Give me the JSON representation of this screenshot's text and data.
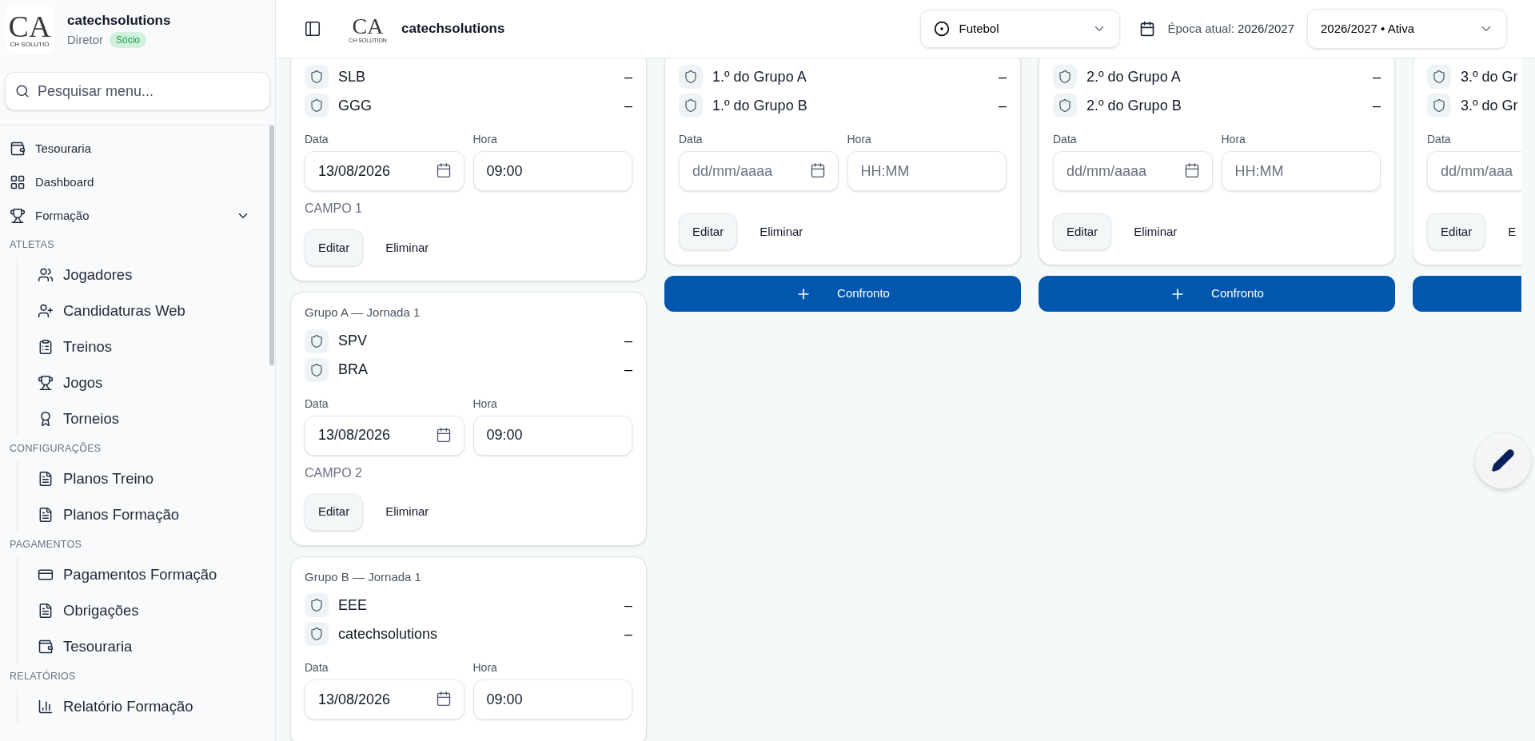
{
  "sidebar": {
    "logo": {
      "mark": "CA",
      "sub": "CH SOLUTIO"
    },
    "org_name": "catechsolutions",
    "role": "Diretor",
    "badge": "Sócio",
    "search": {
      "placeholder": "Pesquisar menu..."
    },
    "items": [
      {
        "kind": "item",
        "label": "Tesouraria"
      },
      {
        "kind": "item",
        "label": "Dashboard"
      },
      {
        "kind": "group",
        "label": "Formação",
        "expanded": true
      },
      {
        "kind": "section",
        "label": "ATLETAS",
        "children": [
          {
            "label": "Jogadores"
          },
          {
            "label": "Candidaturas Web"
          },
          {
            "label": "Treinos"
          },
          {
            "label": "Jogos"
          },
          {
            "label": "Torneios"
          }
        ]
      },
      {
        "kind": "section",
        "label": "CONFIGURAÇÕES",
        "children": [
          {
            "label": "Planos Treino"
          },
          {
            "label": "Planos Formação"
          }
        ]
      },
      {
        "kind": "section",
        "label": "PAGAMENTOS",
        "children": [
          {
            "label": "Pagamentos Formação"
          },
          {
            "label": "Obrigações"
          },
          {
            "label": "Tesouraria"
          }
        ]
      },
      {
        "kind": "section",
        "label": "RELATÓRIOS",
        "children": [
          {
            "label": "Relatório Formação"
          }
        ]
      }
    ]
  },
  "header": {
    "logo": {
      "mark": "CA",
      "sub": "CH SOLUTION"
    },
    "brand": "catechsolutions",
    "sport_select": "Futebol",
    "season_label": "Época atual:",
    "season_value": "2026/2027",
    "season_select": "2026/2027 • Ativa"
  },
  "columns": [
    {
      "matches": [
        {
          "teams": [
            {
              "name": "SLB",
              "score": "–"
            },
            {
              "name": "GGG",
              "score": "–"
            }
          ],
          "date_label": "Data",
          "date": "13/08/2026",
          "time_label": "Hora",
          "time": "09:00",
          "campo": "CAMPO 1",
          "edit": "Editar",
          "delete": "Eliminar"
        },
        {
          "group_label": "Grupo A — Jornada 1",
          "teams": [
            {
              "name": "SPV",
              "score": "–"
            },
            {
              "name": "BRA",
              "score": "–"
            }
          ],
          "date_label": "Data",
          "date": "13/08/2026",
          "time_label": "Hora",
          "time": "09:00",
          "campo": "CAMPO 2",
          "edit": "Editar",
          "delete": "Eliminar"
        },
        {
          "group_label": "Grupo B — Jornada 1",
          "teams": [
            {
              "name": "EEE",
              "score": "–"
            },
            {
              "name": "catechsolutions",
              "score": "–"
            }
          ],
          "date_label": "Data",
          "date": "13/08/2026",
          "time_label": "Hora",
          "time": "09:00"
        }
      ]
    },
    {
      "matches": [
        {
          "teams": [
            {
              "name": "1.º do Grupo A",
              "score": "–"
            },
            {
              "name": "1.º do Grupo B",
              "score": "–"
            }
          ],
          "date_label": "Data",
          "date_placeholder": "dd/mm/aaaa",
          "time_label": "Hora",
          "time_placeholder": "HH:MM",
          "edit": "Editar",
          "delete": "Eliminar"
        }
      ],
      "has_add_button": true,
      "add_label": "Confronto"
    },
    {
      "matches": [
        {
          "teams": [
            {
              "name": "2.º do Grupo A",
              "score": "–"
            },
            {
              "name": "2.º do Grupo B",
              "score": "–"
            }
          ],
          "date_label": "Data",
          "date_placeholder": "dd/mm/aaaa",
          "time_label": "Hora",
          "time_placeholder": "HH:MM",
          "edit": "Editar",
          "delete": "Eliminar"
        }
      ],
      "has_add_button": true,
      "add_label": "Confronto"
    },
    {
      "matches": [
        {
          "teams": [
            {
              "name": "3.º do Gr"
            },
            {
              "name": "3.º do Gr"
            }
          ],
          "date_label": "Data",
          "date_placeholder": "dd/mm/aaa",
          "edit": "Editar",
          "delete": "E"
        }
      ],
      "has_add_button": true
    }
  ]
}
